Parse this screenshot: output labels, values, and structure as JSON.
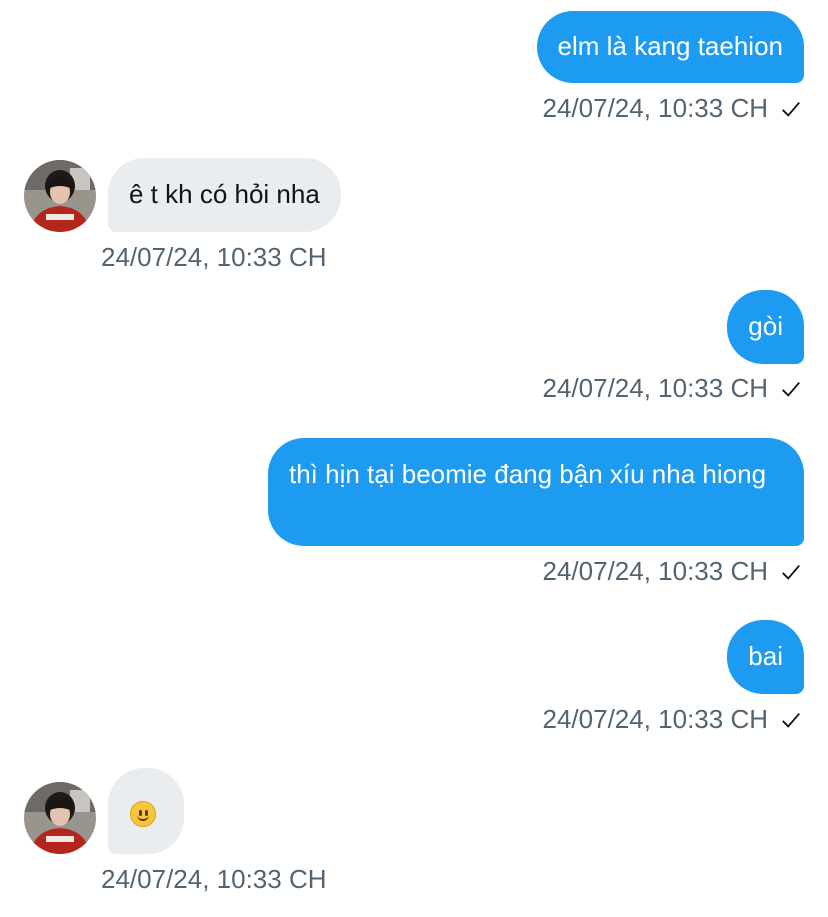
{
  "messages": [
    {
      "direction": "out",
      "text": "elm là kang taehion",
      "timestamp": "24/07/24, 10:33 CH",
      "status": "sent"
    },
    {
      "direction": "in",
      "text": "ê t kh có hỏi nha",
      "timestamp": "24/07/24, 10:33 CH"
    },
    {
      "direction": "out",
      "text": "gòi",
      "timestamp": "24/07/24, 10:33 CH",
      "status": "sent"
    },
    {
      "direction": "out",
      "text": "thì hịn tại beomie đang bận xíu nha hiong",
      "timestamp": "24/07/24, 10:33 CH",
      "status": "sent"
    },
    {
      "direction": "out",
      "text": "bai",
      "timestamp": "24/07/24, 10:33 CH",
      "status": "sent"
    },
    {
      "direction": "in",
      "emoji": "slightly-smiling-face",
      "timestamp": "24/07/24, 10:33 CH"
    }
  ],
  "colors": {
    "outgoing_bubble": "#1d9bf0",
    "incoming_bubble": "#e9edf0",
    "timestamp_text": "#536471"
  },
  "icons": {
    "sent_status": "checkmark-icon",
    "contact_avatar": "avatar"
  }
}
